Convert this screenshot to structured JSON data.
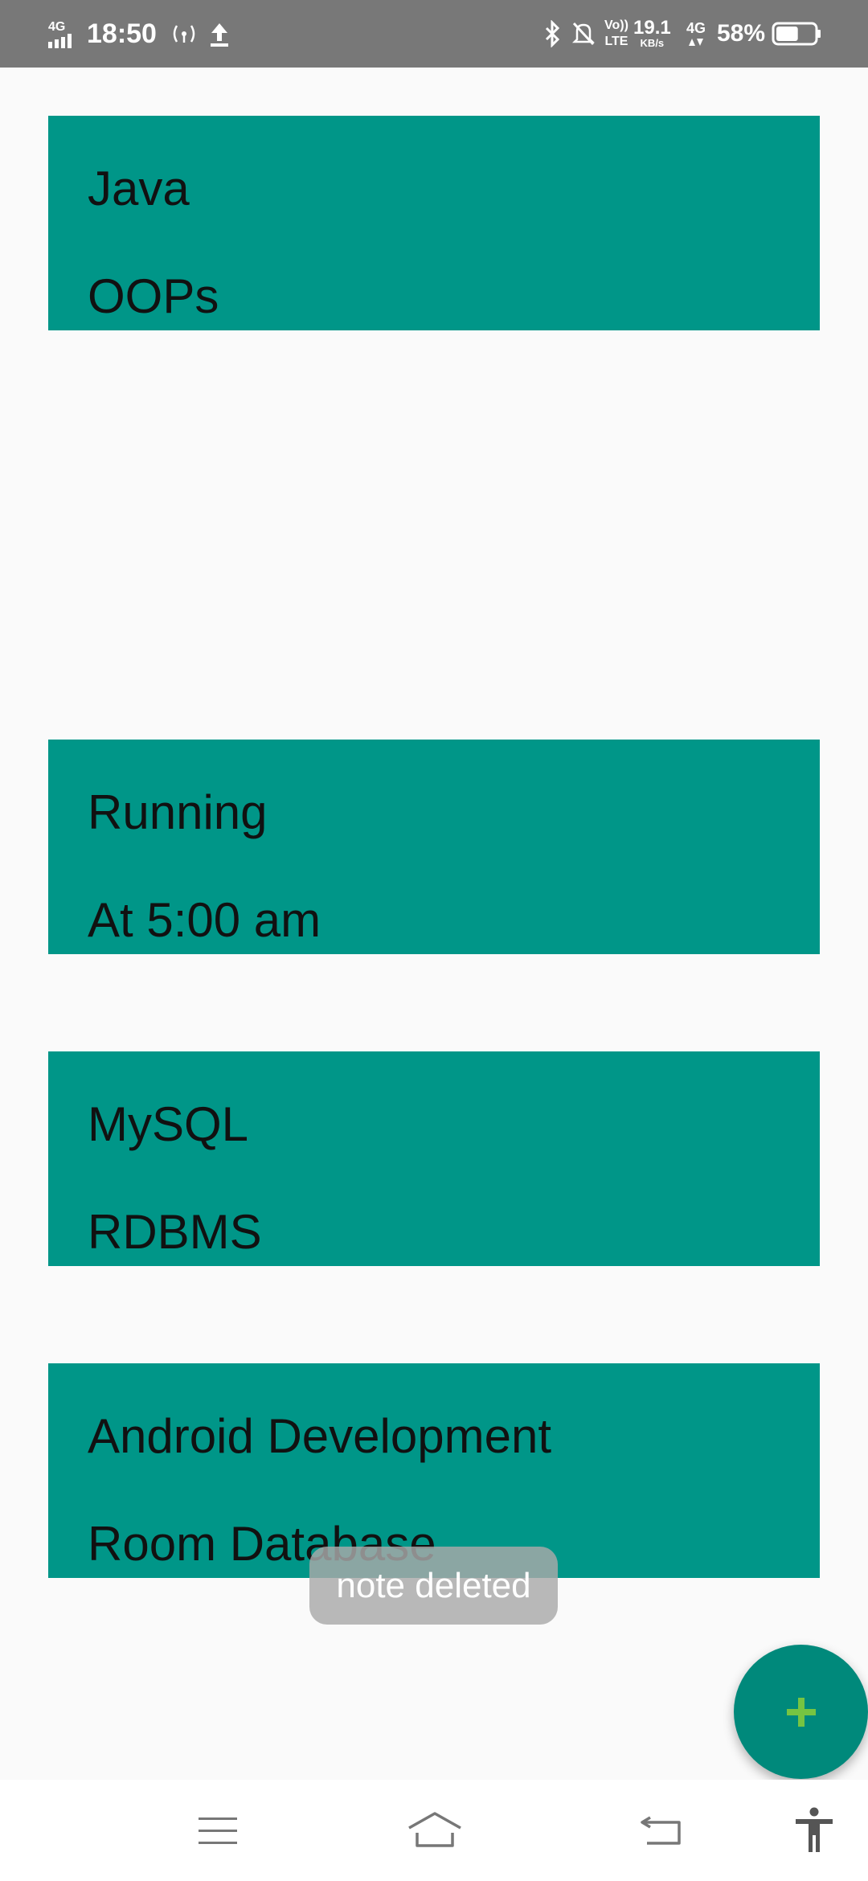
{
  "status_bar": {
    "network_type": "4G",
    "time": "18:50",
    "data_speed_value": "19.1",
    "data_speed_unit": "KB/s",
    "volte_label_top": "Vo))",
    "volte_label_bottom": "LTE",
    "network_type_2": "4G",
    "battery_percent": "58%",
    "battery_level": 0.58,
    "icons": [
      "signal-icon",
      "hotspot-icon",
      "upload-icon",
      "bluetooth-icon",
      "mute-icon",
      "volte-icon",
      "data-arrows-icon",
      "battery-icon"
    ]
  },
  "notes": [
    {
      "title": "Java",
      "description": "OOPs"
    },
    {
      "title": "Running",
      "description": "At 5:00 am"
    },
    {
      "title": "MySQL",
      "description": "RDBMS"
    },
    {
      "title": "Android Development",
      "description": "Room Database"
    }
  ],
  "toast": {
    "message": "note deleted"
  },
  "fab": {
    "icon": "plus-icon",
    "background": "#00897b",
    "icon_color": "#76c442"
  },
  "nav_bar": {
    "buttons": [
      "menu-icon",
      "home-icon",
      "back-icon",
      "accessibility-icon"
    ]
  },
  "colors": {
    "status_bar": "#787878",
    "card_background": "#009688",
    "page_background": "#fafafa",
    "card_text": "#111111"
  }
}
